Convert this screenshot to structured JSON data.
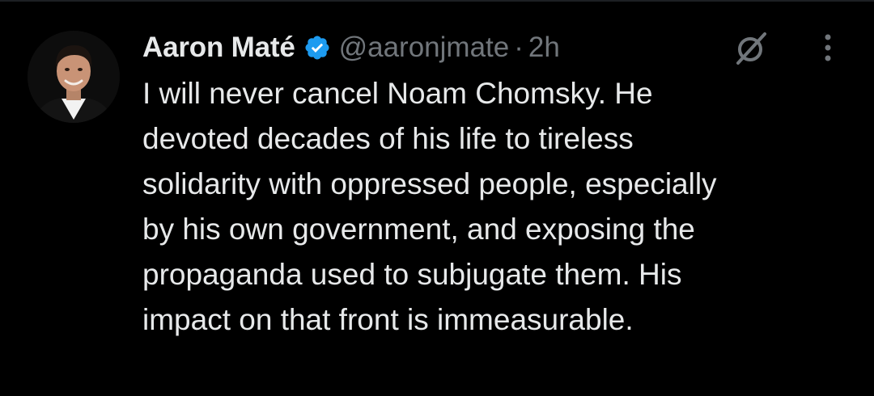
{
  "tweet": {
    "author": {
      "display_name": "Aaron Maté",
      "handle": "@aaronjmate",
      "verified": true
    },
    "separator": "·",
    "time": "2h",
    "lines": [
      "I will never cancel Noam Chomsky. He",
      "devoted decades of his life to tireless",
      "solidarity with oppressed people, especially",
      "by his own government, and exposing the",
      "propaganda used to subjugate them. His",
      "impact on that front is immeasurable."
    ]
  },
  "icons": {
    "avatar": "avatar",
    "verified": "verified-badge-icon",
    "grok": "grok-icon",
    "more": "more-vertical-icon"
  },
  "colors": {
    "background": "#000000",
    "text_primary": "#e7e9ea",
    "text_secondary": "#71767b",
    "verified_blue": "#1d9bf0"
  }
}
